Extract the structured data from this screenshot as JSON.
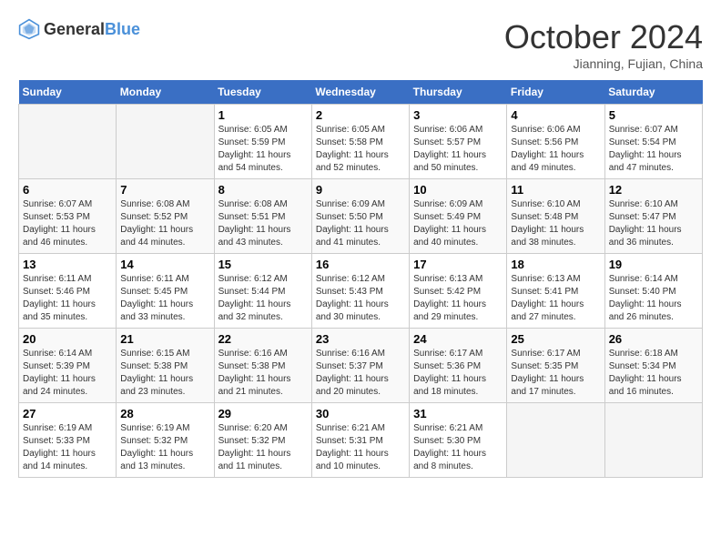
{
  "header": {
    "logo_general": "General",
    "logo_blue": "Blue",
    "month": "October 2024",
    "location": "Jianning, Fujian, China"
  },
  "weekdays": [
    "Sunday",
    "Monday",
    "Tuesday",
    "Wednesday",
    "Thursday",
    "Friday",
    "Saturday"
  ],
  "weeks": [
    [
      {
        "day": "",
        "info": ""
      },
      {
        "day": "",
        "info": ""
      },
      {
        "day": "1",
        "info": "Sunrise: 6:05 AM\nSunset: 5:59 PM\nDaylight: 11 hours and 54 minutes."
      },
      {
        "day": "2",
        "info": "Sunrise: 6:05 AM\nSunset: 5:58 PM\nDaylight: 11 hours and 52 minutes."
      },
      {
        "day": "3",
        "info": "Sunrise: 6:06 AM\nSunset: 5:57 PM\nDaylight: 11 hours and 50 minutes."
      },
      {
        "day": "4",
        "info": "Sunrise: 6:06 AM\nSunset: 5:56 PM\nDaylight: 11 hours and 49 minutes."
      },
      {
        "day": "5",
        "info": "Sunrise: 6:07 AM\nSunset: 5:54 PM\nDaylight: 11 hours and 47 minutes."
      }
    ],
    [
      {
        "day": "6",
        "info": "Sunrise: 6:07 AM\nSunset: 5:53 PM\nDaylight: 11 hours and 46 minutes."
      },
      {
        "day": "7",
        "info": "Sunrise: 6:08 AM\nSunset: 5:52 PM\nDaylight: 11 hours and 44 minutes."
      },
      {
        "day": "8",
        "info": "Sunrise: 6:08 AM\nSunset: 5:51 PM\nDaylight: 11 hours and 43 minutes."
      },
      {
        "day": "9",
        "info": "Sunrise: 6:09 AM\nSunset: 5:50 PM\nDaylight: 11 hours and 41 minutes."
      },
      {
        "day": "10",
        "info": "Sunrise: 6:09 AM\nSunset: 5:49 PM\nDaylight: 11 hours and 40 minutes."
      },
      {
        "day": "11",
        "info": "Sunrise: 6:10 AM\nSunset: 5:48 PM\nDaylight: 11 hours and 38 minutes."
      },
      {
        "day": "12",
        "info": "Sunrise: 6:10 AM\nSunset: 5:47 PM\nDaylight: 11 hours and 36 minutes."
      }
    ],
    [
      {
        "day": "13",
        "info": "Sunrise: 6:11 AM\nSunset: 5:46 PM\nDaylight: 11 hours and 35 minutes."
      },
      {
        "day": "14",
        "info": "Sunrise: 6:11 AM\nSunset: 5:45 PM\nDaylight: 11 hours and 33 minutes."
      },
      {
        "day": "15",
        "info": "Sunrise: 6:12 AM\nSunset: 5:44 PM\nDaylight: 11 hours and 32 minutes."
      },
      {
        "day": "16",
        "info": "Sunrise: 6:12 AM\nSunset: 5:43 PM\nDaylight: 11 hours and 30 minutes."
      },
      {
        "day": "17",
        "info": "Sunrise: 6:13 AM\nSunset: 5:42 PM\nDaylight: 11 hours and 29 minutes."
      },
      {
        "day": "18",
        "info": "Sunrise: 6:13 AM\nSunset: 5:41 PM\nDaylight: 11 hours and 27 minutes."
      },
      {
        "day": "19",
        "info": "Sunrise: 6:14 AM\nSunset: 5:40 PM\nDaylight: 11 hours and 26 minutes."
      }
    ],
    [
      {
        "day": "20",
        "info": "Sunrise: 6:14 AM\nSunset: 5:39 PM\nDaylight: 11 hours and 24 minutes."
      },
      {
        "day": "21",
        "info": "Sunrise: 6:15 AM\nSunset: 5:38 PM\nDaylight: 11 hours and 23 minutes."
      },
      {
        "day": "22",
        "info": "Sunrise: 6:16 AM\nSunset: 5:38 PM\nDaylight: 11 hours and 21 minutes."
      },
      {
        "day": "23",
        "info": "Sunrise: 6:16 AM\nSunset: 5:37 PM\nDaylight: 11 hours and 20 minutes."
      },
      {
        "day": "24",
        "info": "Sunrise: 6:17 AM\nSunset: 5:36 PM\nDaylight: 11 hours and 18 minutes."
      },
      {
        "day": "25",
        "info": "Sunrise: 6:17 AM\nSunset: 5:35 PM\nDaylight: 11 hours and 17 minutes."
      },
      {
        "day": "26",
        "info": "Sunrise: 6:18 AM\nSunset: 5:34 PM\nDaylight: 11 hours and 16 minutes."
      }
    ],
    [
      {
        "day": "27",
        "info": "Sunrise: 6:19 AM\nSunset: 5:33 PM\nDaylight: 11 hours and 14 minutes."
      },
      {
        "day": "28",
        "info": "Sunrise: 6:19 AM\nSunset: 5:32 PM\nDaylight: 11 hours and 13 minutes."
      },
      {
        "day": "29",
        "info": "Sunrise: 6:20 AM\nSunset: 5:32 PM\nDaylight: 11 hours and 11 minutes."
      },
      {
        "day": "30",
        "info": "Sunrise: 6:21 AM\nSunset: 5:31 PM\nDaylight: 11 hours and 10 minutes."
      },
      {
        "day": "31",
        "info": "Sunrise: 6:21 AM\nSunset: 5:30 PM\nDaylight: 11 hours and 8 minutes."
      },
      {
        "day": "",
        "info": ""
      },
      {
        "day": "",
        "info": ""
      }
    ]
  ]
}
